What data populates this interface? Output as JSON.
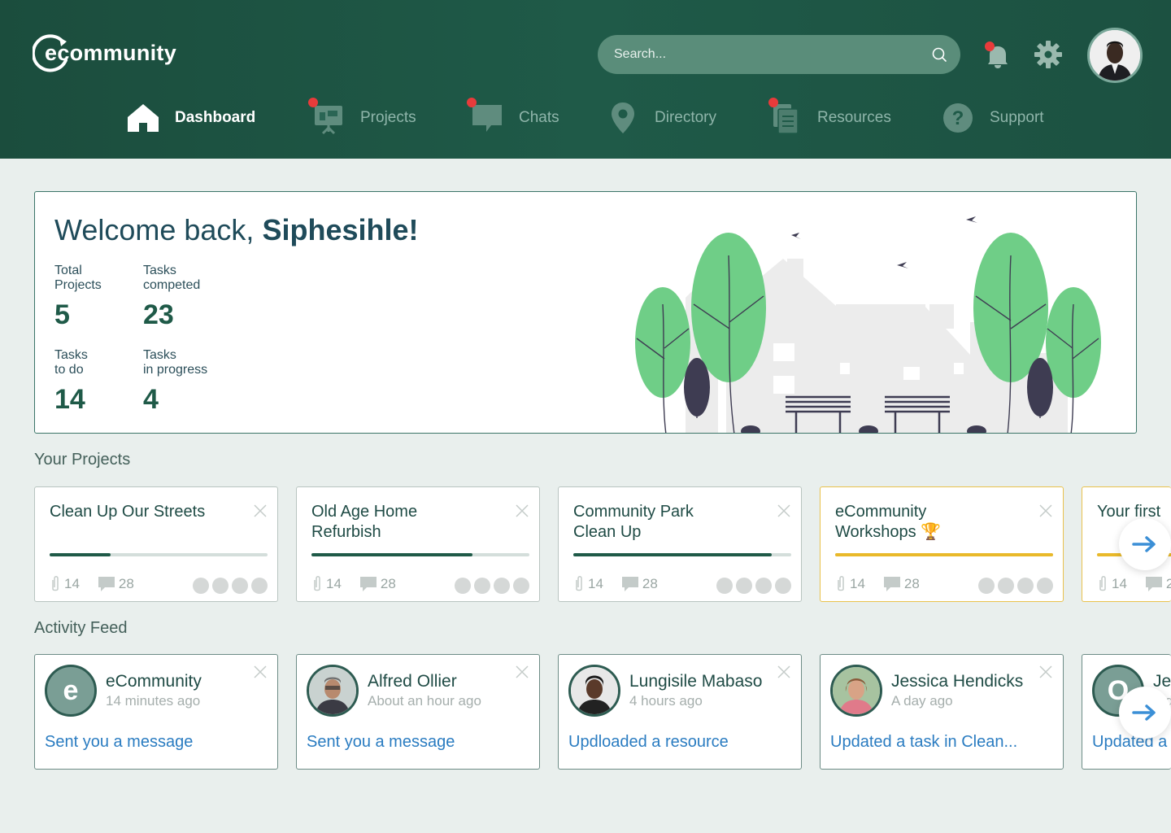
{
  "brand": {
    "name": "ecommunity"
  },
  "search": {
    "placeholder": "Search..."
  },
  "nav": [
    {
      "label": "Dashboard"
    },
    {
      "label": "Projects"
    },
    {
      "label": "Chats"
    },
    {
      "label": "Directory"
    },
    {
      "label": "Resources"
    },
    {
      "label": "Support"
    }
  ],
  "welcome": {
    "greeting": "Welcome back,",
    "name": "Siphesihle!",
    "stats": [
      {
        "label1": "Total",
        "label2": "Projects",
        "value": "5"
      },
      {
        "label1": "Tasks",
        "label2": "competed",
        "value": "23"
      },
      {
        "label1": "Tasks",
        "label2": "to do",
        "value": "14"
      },
      {
        "label1": "Tasks",
        "label2": "in progress",
        "value": "4"
      }
    ]
  },
  "sections": {
    "projects": "Your Projects",
    "activity": "Activity Feed"
  },
  "projects": [
    {
      "line1": "Clean Up Our Streets",
      "line2": "",
      "progress": 0.28,
      "attachments": "14",
      "comments": "28"
    },
    {
      "line1": "Old Age Home",
      "line2": "Refurbish",
      "progress": 0.74,
      "attachments": "14",
      "comments": "28"
    },
    {
      "line1": "Community Park",
      "line2": "Clean Up",
      "progress": 0.91,
      "attachments": "14",
      "comments": "28"
    },
    {
      "line1": "eCommunity",
      "line2": "Workshops",
      "progress": 1.0,
      "attachments": "14",
      "comments": "28",
      "trophy": "🏆"
    },
    {
      "line1": "Your first",
      "line2": "",
      "progress": 1.0,
      "attachments": "14",
      "comments": "2"
    }
  ],
  "activity": [
    {
      "name": "eCommunity",
      "time": "14 minutes ago",
      "message": "Sent you a message",
      "letter": "e"
    },
    {
      "name": "Alfred Ollier",
      "time": "About an hour ago",
      "message": "Sent you a message"
    },
    {
      "name": "Lungisile Mabaso",
      "time": "4 hours ago",
      "message": "Updloaded a resource"
    },
    {
      "name": "Jessica Hendicks",
      "time": "A day ago",
      "message": "Updated a task in Clean..."
    },
    {
      "name": "Je",
      "time": "A d",
      "message": "Updated a",
      "letter": "O"
    }
  ],
  "colors": {
    "header": "#1f5a48",
    "accent": "#1f5a48",
    "gold": "#e9b92a",
    "link": "#2a7cc1",
    "notification": "#e83b3b"
  }
}
